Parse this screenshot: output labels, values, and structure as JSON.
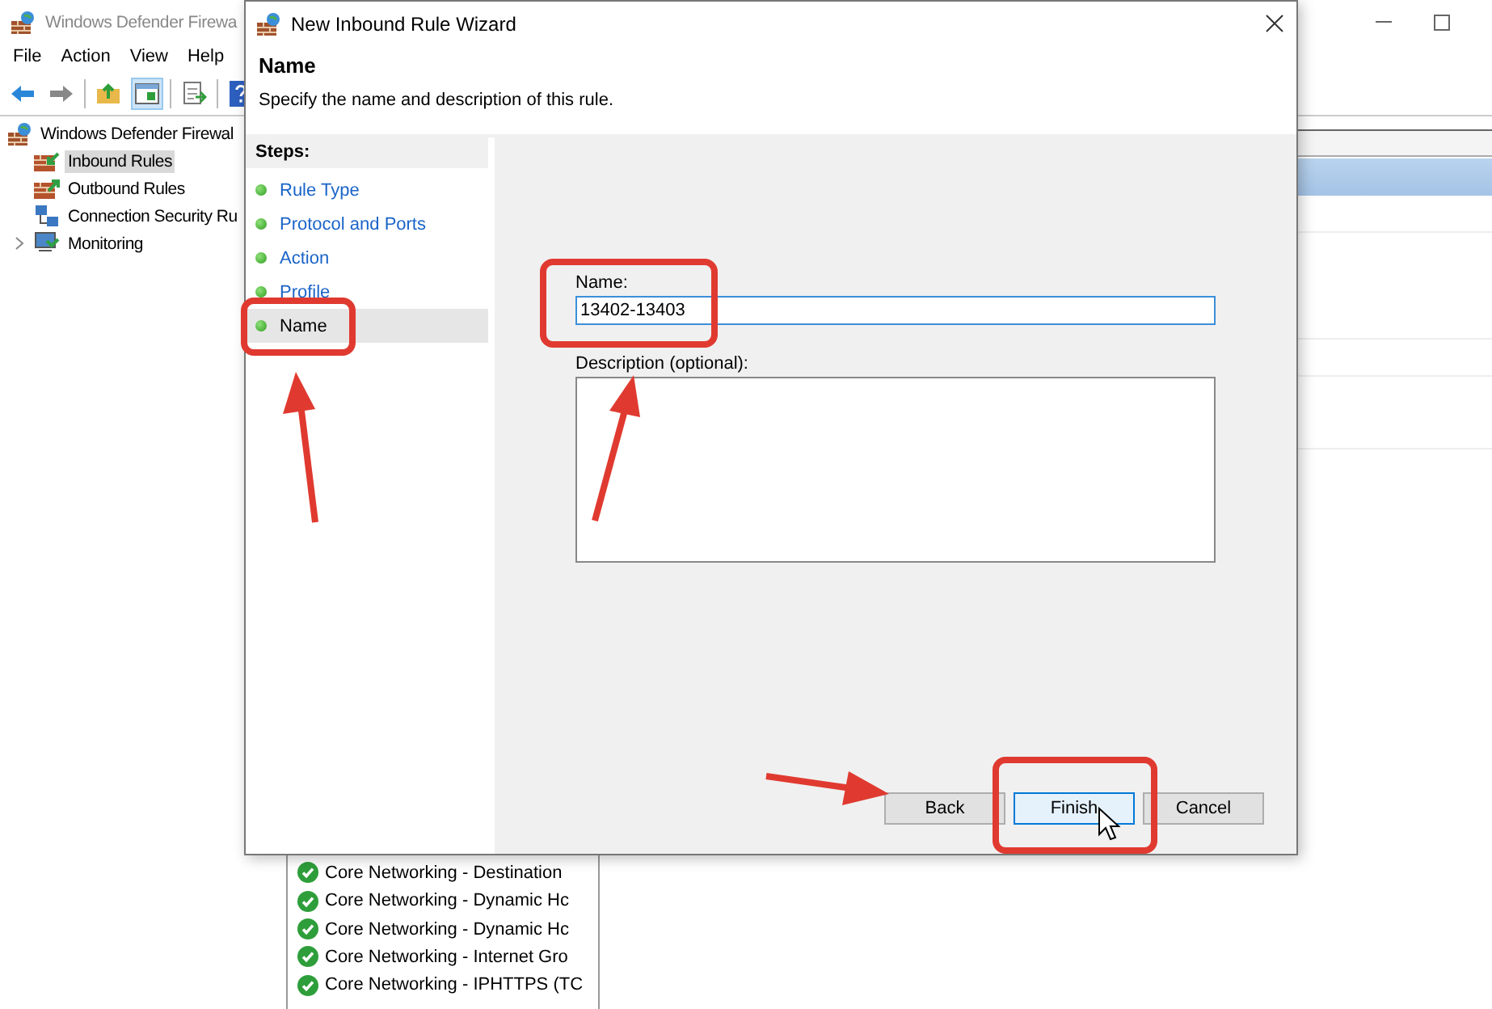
{
  "main_window": {
    "title": "Windows Defender Firewa",
    "menu": [
      "File",
      "Action",
      "View",
      "Help"
    ],
    "tree": {
      "label": "Windows Defender Firewal",
      "children": [
        {
          "label": "Inbound Rules",
          "kind": "inbound",
          "selected": true,
          "expandable": false
        },
        {
          "label": "Outbound Rules",
          "kind": "outbound",
          "selected": false,
          "expandable": false
        },
        {
          "label": "Connection Security Ru",
          "kind": "connection",
          "selected": false,
          "expandable": false
        },
        {
          "label": "Monitoring",
          "kind": "monitor",
          "selected": false,
          "expandable": true
        }
      ]
    },
    "rules": [
      "Core Networking - Destination",
      "Core Networking - Dynamic Hc",
      "Core Networking - Dynamic Hc",
      "Core Networking - Internet Gro",
      "Core Networking - IPHTTPS (TC"
    ]
  },
  "dialog": {
    "title": "New Inbound Rule Wizard",
    "heading": "Name",
    "subtitle": "Specify the name and description of this rule.",
    "steps_header": "Steps:",
    "steps": [
      {
        "label": "Rule Type",
        "selected": false
      },
      {
        "label": "Protocol and Ports",
        "selected": false
      },
      {
        "label": "Action",
        "selected": false
      },
      {
        "label": "Profile",
        "selected": false
      },
      {
        "label": "Name",
        "selected": true
      }
    ],
    "name_label": "Name:",
    "name_value": "13402-13403",
    "description_label": "Description (optional):",
    "buttons": [
      {
        "label": "Back",
        "default": false
      },
      {
        "label": "Finish",
        "default": true
      },
      {
        "label": "Cancel",
        "default": false
      }
    ]
  }
}
